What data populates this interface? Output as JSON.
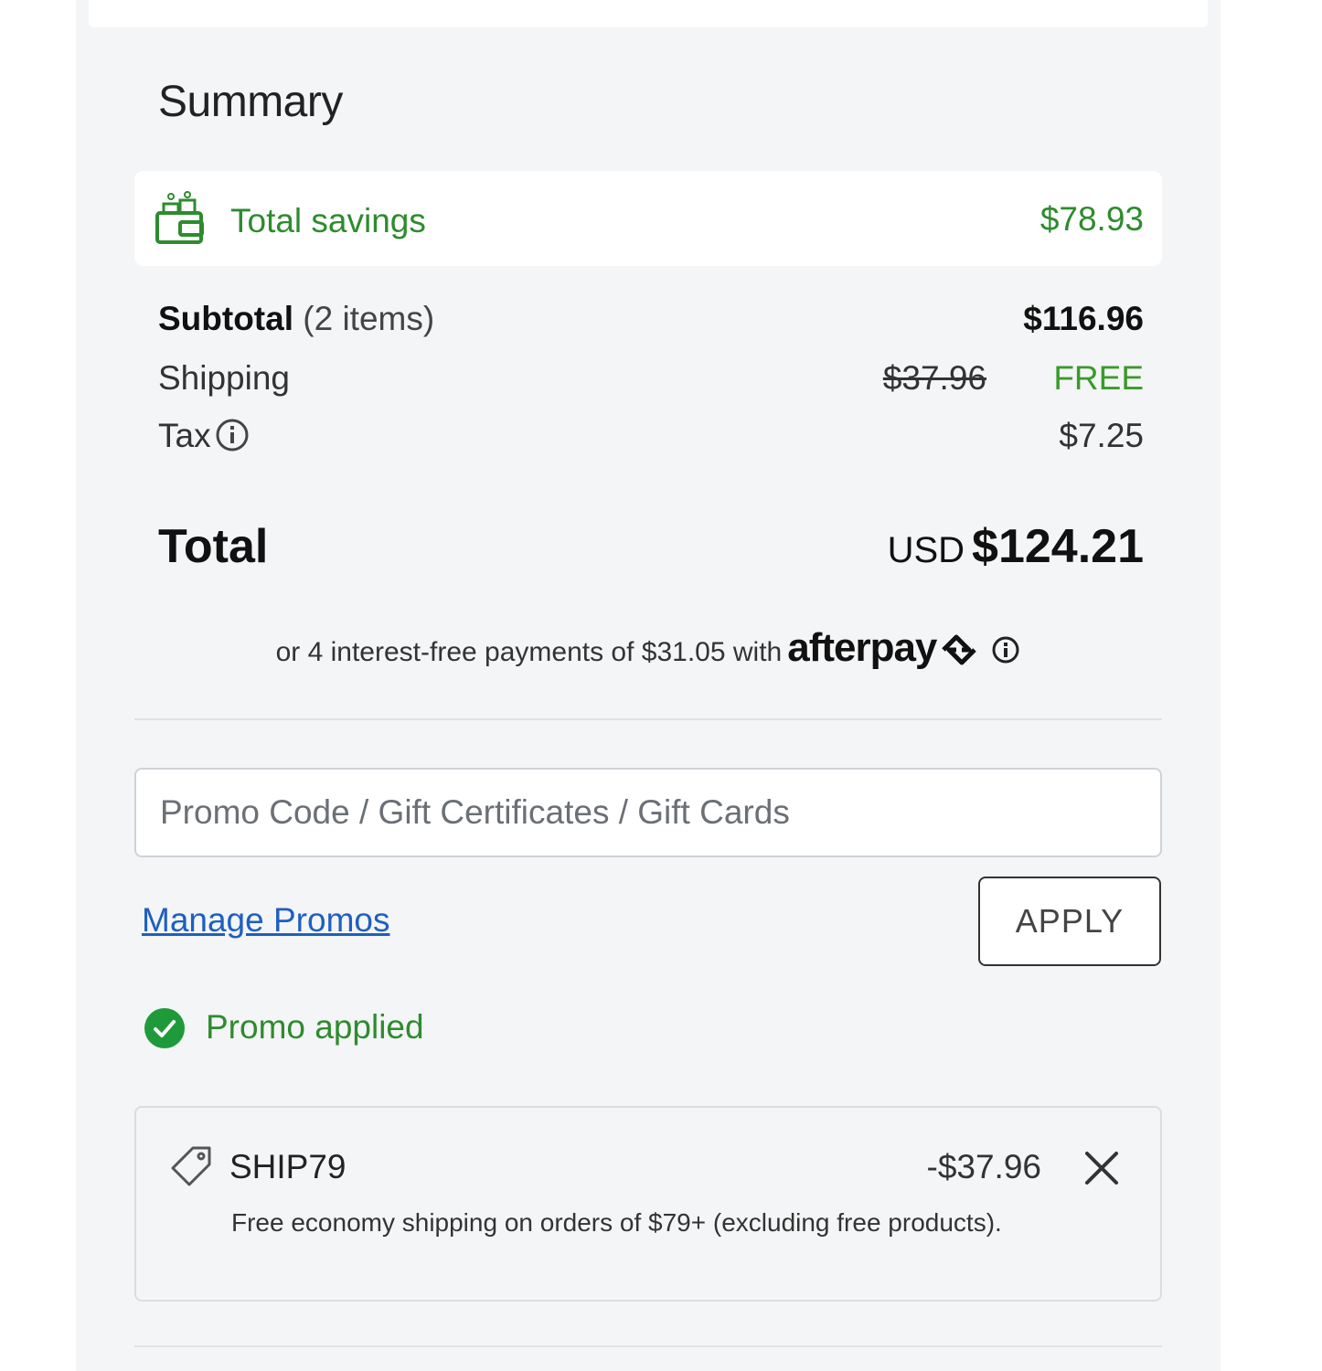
{
  "summary": {
    "title": "Summary"
  },
  "savings": {
    "icon": "wallet-savings-icon",
    "label": "Total savings",
    "value": "$78.93",
    "color": "#2e8b2e"
  },
  "lines": {
    "subtotal": {
      "label": "Subtotal",
      "count": "(2 items)",
      "value": "$116.96"
    },
    "shipping": {
      "label": "Shipping",
      "original": "$37.96",
      "value": "FREE"
    },
    "tax": {
      "label": "Tax",
      "info_icon": "info-icon",
      "value": "$7.25"
    }
  },
  "total": {
    "label": "Total",
    "currency": "USD",
    "amount": "$124.21"
  },
  "afterpay": {
    "text": "or 4 interest-free payments of $31.05 with",
    "brand": "afterpay",
    "icon": "afterpay-logo-icon",
    "info_icon": "info-icon"
  },
  "promo": {
    "placeholder": "Promo Code / Gift Certificates / Gift Cards",
    "value": "",
    "manage_label": "Manage Promos",
    "apply_label": "APPLY",
    "status_text": "Promo applied",
    "status_icon": "check-circle-icon",
    "applied": {
      "code": "SHIP79",
      "discount": "-$37.96",
      "description": "Free economy shipping on orders of $79+ (excluding free products).",
      "tag_icon": "tag-icon",
      "remove_icon": "close-icon"
    }
  },
  "colors": {
    "accent_green": "#2e8b2e",
    "link_blue": "#1f5fbf",
    "panel_bg": "#f4f5f7"
  }
}
